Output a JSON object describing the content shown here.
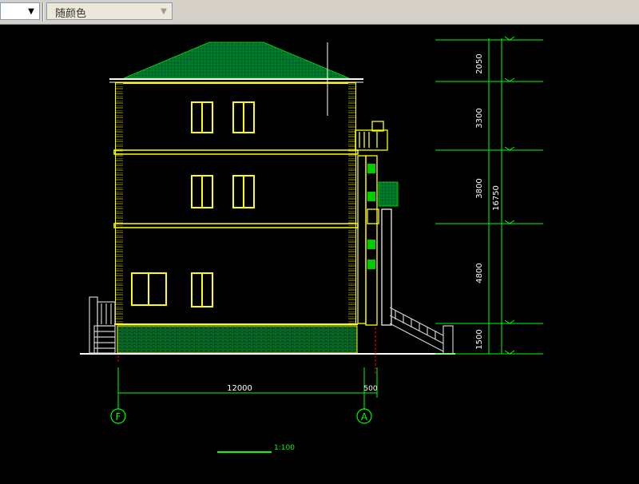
{
  "toolbar": {
    "layer_dropdown_value": "",
    "color_dropdown_value": "随颜色"
  },
  "drawing": {
    "dimensions_right": [
      "2050",
      "3300",
      "3800",
      "4800",
      "1500"
    ],
    "total_height": "16750",
    "dimension_bottom_main": "12000",
    "dimension_bottom_small": "500",
    "axis_left": "F",
    "axis_right": "A",
    "scale": "1:100"
  },
  "colors": {
    "background": "#000000",
    "wall": "#ffff00",
    "roof": "#00c000",
    "dimension": "#00ff00",
    "text": "#ffffff"
  }
}
